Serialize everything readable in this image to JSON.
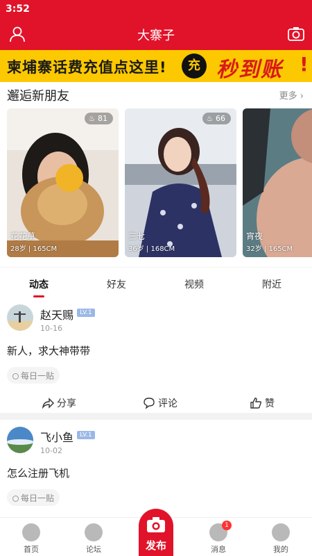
{
  "status": {
    "time": "3:52"
  },
  "header": {
    "title": "大寨子",
    "user_icon": "user-icon",
    "camera_icon": "camera-icon"
  },
  "banner": {
    "part1": "柬埔寨",
    "part2": "话费充值",
    "part3": "点这里!",
    "badge": "充",
    "big": "秒到账",
    "exclaim": "!",
    "colors": {
      "bg": "#fcc800",
      "accent": "#d81a1a"
    }
  },
  "section": {
    "title": "邂逅新朋友",
    "more": "更多"
  },
  "cards": [
    {
      "heat": "81",
      "name": "花花草",
      "age": "28岁",
      "height": "165CM"
    },
    {
      "heat": "66",
      "name": "三七",
      "age": "36岁",
      "height": "168CM"
    },
    {
      "heat": "",
      "name": "宵夜",
      "age": "32岁",
      "height": "165CM"
    }
  ],
  "tabs": [
    "动态",
    "好友",
    "视频",
    "附近"
  ],
  "posts": [
    {
      "user": "赵天赐",
      "level": "LV.1",
      "date": "10-16",
      "content": "新人，求大神带带",
      "tag": "每日一贴"
    },
    {
      "user": "飞小鱼",
      "level": "LV.1",
      "date": "10-02",
      "content": "怎么注册飞机",
      "tag": "每日一贴"
    }
  ],
  "actions": {
    "share": "分享",
    "comment": "评论",
    "like": "赞"
  },
  "tabbar": {
    "home": "首页",
    "forum": "论坛",
    "publish": "发布",
    "messages": "消息",
    "messages_badge": "1",
    "mine": "我的"
  },
  "colors": {
    "brand": "#e0132a",
    "level_badge": "#9ab8e6"
  }
}
